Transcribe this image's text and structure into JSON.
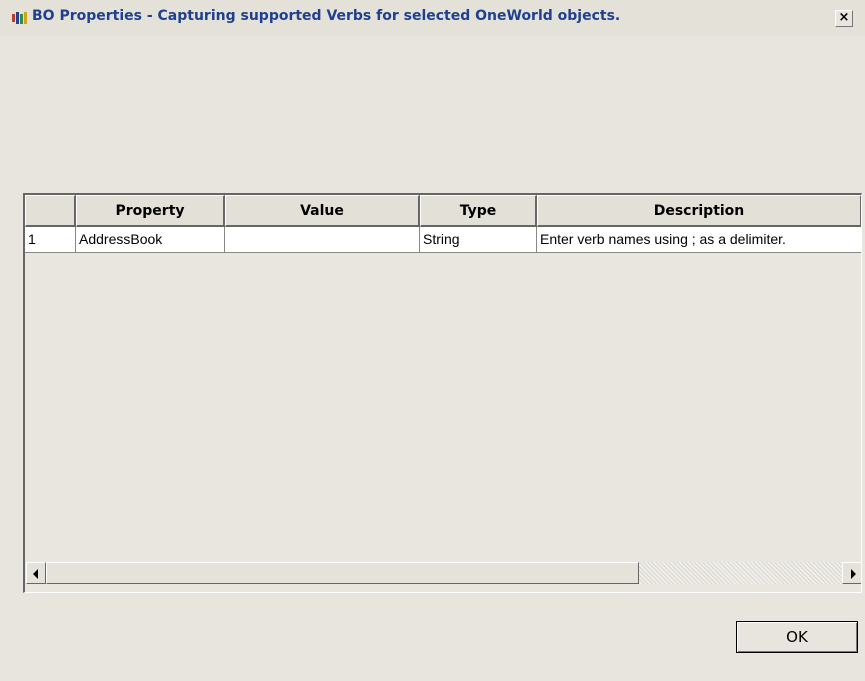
{
  "window": {
    "title": "BO Properties - Capturing supported Verbs for selected OneWorld objects.",
    "close_label": "×"
  },
  "grid": {
    "columns": [
      "",
      "Property",
      "Value",
      "Type",
      "Description"
    ],
    "rows": [
      {
        "num": "1",
        "property": "AddressBook",
        "value": "",
        "type": "String",
        "description": "Enter verb names using ; as a delimiter."
      }
    ]
  },
  "scrollbar": {
    "left_icon": "arrow-left-icon",
    "right_icon": "arrow-right-icon"
  },
  "buttons": {
    "ok_label": "OK"
  },
  "colors": {
    "title_text": "#1f3f8f",
    "background": "#e8e5de"
  }
}
